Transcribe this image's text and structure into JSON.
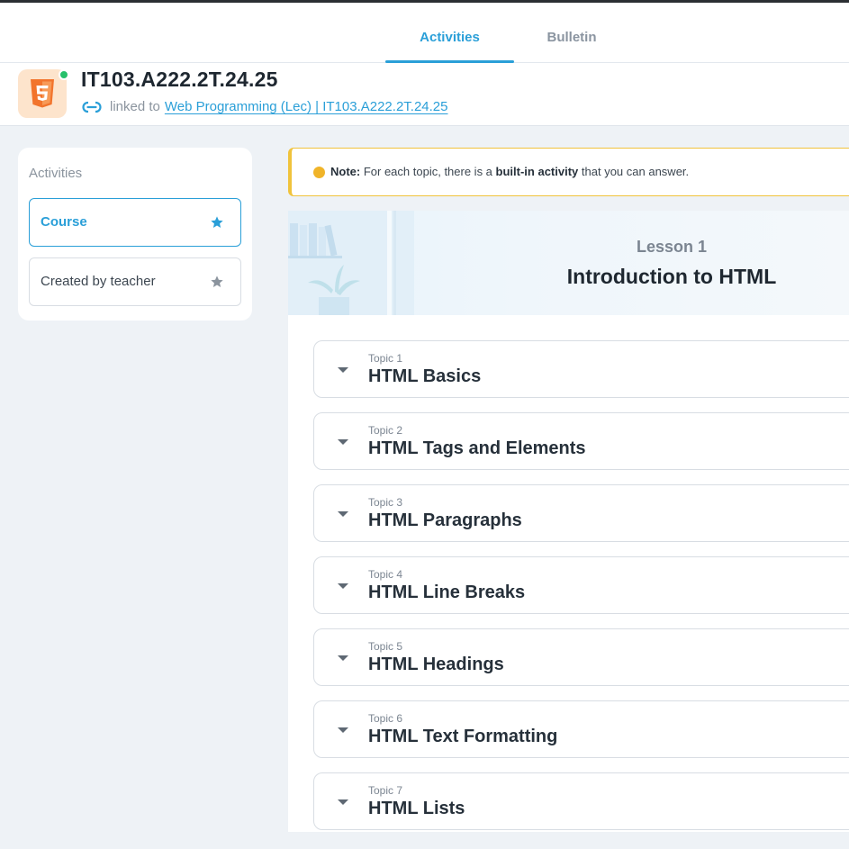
{
  "tabs": [
    {
      "label": "Activities",
      "active": true
    },
    {
      "label": "Bulletin",
      "active": false
    }
  ],
  "course": {
    "icon": "html5-icon",
    "title": "IT103.A222.2T.24.25",
    "linked_prefix": "linked to",
    "linked_name": "Web Programming (Lec) | IT103.A222.2T.24.25",
    "status_color": "#27c06a"
  },
  "sidebar": {
    "heading": "Activities",
    "items": [
      {
        "label": "Course",
        "active": true
      },
      {
        "label": "Created by teacher",
        "active": false
      }
    ]
  },
  "note": {
    "label": "Note:",
    "text_before": "For each topic, there is a",
    "bold": "built-in activity",
    "text_after": "that you can answer."
  },
  "lesson": {
    "number": "Lesson 1",
    "title": "Introduction to HTML"
  },
  "topics": [
    {
      "number": "Topic 1",
      "title": "HTML Basics"
    },
    {
      "number": "Topic 2",
      "title": "HTML Tags and Elements"
    },
    {
      "number": "Topic 3",
      "title": "HTML Paragraphs"
    },
    {
      "number": "Topic 4",
      "title": "HTML Line Breaks"
    },
    {
      "number": "Topic 5",
      "title": "HTML Headings"
    },
    {
      "number": "Topic 6",
      "title": "HTML Text Formatting"
    },
    {
      "number": "Topic 7",
      "title": "HTML Lists"
    }
  ],
  "colors": {
    "accent": "#2a9fd8",
    "note_border": "#f0c33c",
    "html5_orange": "#f2742c"
  }
}
